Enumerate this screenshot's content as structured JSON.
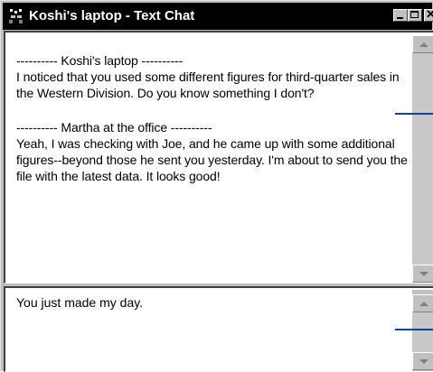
{
  "window": {
    "title": "Koshi's laptop - Text Chat",
    "icon": "chat-app-icon",
    "controls": {
      "minimize_icon": "minimize-icon",
      "maximize_icon": "maximize-icon",
      "close_icon": "close-icon",
      "close_glyph": "✕"
    }
  },
  "transcript": {
    "messages": [
      {
        "sender": "---------- Koshi's laptop ----------",
        "text": "I noticed that you used some different figures for third-quarter sales in the Western Division. Do you know something I don't?"
      },
      {
        "sender": "---------- Martha at the office ----------",
        "text": "Yeah, I was checking with Joe, and he came up with some additional figures--beyond those he sent you yesterday. I'm about to send you the file with the latest data. It looks good!"
      }
    ]
  },
  "compose": {
    "value": "You just made my day."
  },
  "colors": {
    "callout_line": "#1040a0",
    "titlebar": "#000000",
    "chrome": "#c0c0c0"
  }
}
